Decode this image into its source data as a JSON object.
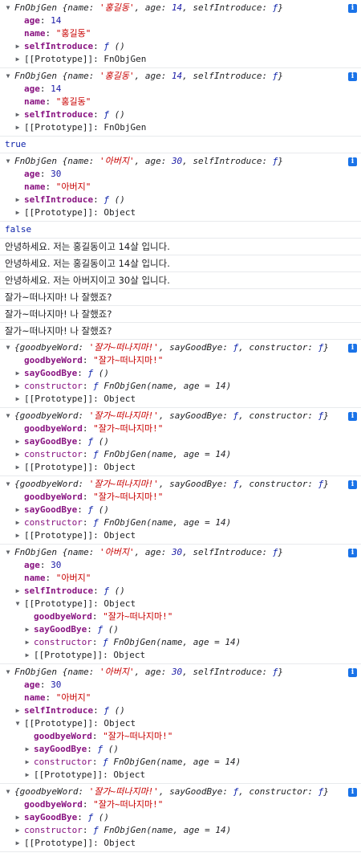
{
  "colors": {
    "string": "#c80000",
    "number": "#1a1aa6",
    "key": "#881280",
    "info_badge": "#1a73e8",
    "separator": "#e8eaed"
  },
  "icons": {
    "expanded": "triangle-down-icon",
    "collapsed": "triangle-right-icon",
    "info": "info-icon"
  },
  "entries": [
    {
      "kind": "object",
      "lines": [
        {
          "indent": 0,
          "tri": "down",
          "html": "<span class='it'>FnObjGen {name: <span class='str'>'홍길동'</span>, age: <span class='num'>14</span>, selfIntroduce: <span class='kw'>ƒ</span>}</span>",
          "info": true
        },
        {
          "indent": 1,
          "tri": "",
          "html": "<span class='keyb'>age</span>: <span class='num'>14</span>"
        },
        {
          "indent": 1,
          "tri": "",
          "html": "<span class='keyb'>name</span>: <span class='str'>\"홍길동\"</span>"
        },
        {
          "indent": 1,
          "tri": "right",
          "html": "<span class='keyb'>selfIntroduce</span>: <span class='it'><span class='kw'>ƒ</span> ()</span>"
        },
        {
          "indent": 1,
          "tri": "right",
          "html": "<span class='dim'>[[Prototype]]</span>: FnObjGen"
        }
      ]
    },
    {
      "kind": "object",
      "lines": [
        {
          "indent": 0,
          "tri": "down",
          "html": "<span class='it'>FnObjGen {name: <span class='str'>'홍길동'</span>, age: <span class='num'>14</span>, selfIntroduce: <span class='kw'>ƒ</span>}</span>",
          "info": true
        },
        {
          "indent": 1,
          "tri": "",
          "html": "<span class='keyb'>age</span>: <span class='num'>14</span>"
        },
        {
          "indent": 1,
          "tri": "",
          "html": "<span class='keyb'>name</span>: <span class='str'>\"홍길동\"</span>"
        },
        {
          "indent": 1,
          "tri": "right",
          "html": "<span class='keyb'>selfIntroduce</span>: <span class='it'><span class='kw'>ƒ</span> ()</span>"
        },
        {
          "indent": 1,
          "tri": "right",
          "html": "<span class='dim'>[[Prototype]]</span>: FnObjGen"
        }
      ]
    },
    {
      "kind": "value",
      "lines": [
        {
          "indent": 0,
          "tri": "",
          "html": "<span class='kw'>true</span>"
        }
      ]
    },
    {
      "kind": "object",
      "lines": [
        {
          "indent": 0,
          "tri": "down",
          "html": "<span class='it'>FnObjGen {name: <span class='str'>'아버지'</span>, age: <span class='num'>30</span>, selfIntroduce: <span class='kw'>ƒ</span>}</span>",
          "info": true
        },
        {
          "indent": 1,
          "tri": "",
          "html": "<span class='keyb'>age</span>: <span class='num'>30</span>"
        },
        {
          "indent": 1,
          "tri": "",
          "html": "<span class='keyb'>name</span>: <span class='str'>\"아버지\"</span>"
        },
        {
          "indent": 1,
          "tri": "right",
          "html": "<span class='keyb'>selfIntroduce</span>: <span class='it'><span class='kw'>ƒ</span> ()</span>"
        },
        {
          "indent": 1,
          "tri": "right",
          "html": "<span class='dim'>[[Prototype]]</span>: Object"
        }
      ]
    },
    {
      "kind": "value",
      "lines": [
        {
          "indent": 0,
          "tri": "",
          "html": "<span class='kw'>false</span>"
        }
      ]
    },
    {
      "kind": "log",
      "lines": [
        {
          "indent": 0,
          "tri": "",
          "html": "<span class='plain'>안녕하세요. 저는 홍길동이고 14살 입니다.</span>"
        }
      ]
    },
    {
      "kind": "log",
      "lines": [
        {
          "indent": 0,
          "tri": "",
          "html": "<span class='plain'>안녕하세요. 저는 홍길동이고 14살 입니다.</span>"
        }
      ]
    },
    {
      "kind": "log",
      "lines": [
        {
          "indent": 0,
          "tri": "",
          "html": "<span class='plain'>안녕하세요. 저는 아버지이고 30살 입니다.</span>"
        }
      ]
    },
    {
      "kind": "log",
      "lines": [
        {
          "indent": 0,
          "tri": "",
          "html": "<span class='plain'>잘가~떠나지마! 나 잘했죠?</span>"
        }
      ]
    },
    {
      "kind": "log",
      "lines": [
        {
          "indent": 0,
          "tri": "",
          "html": "<span class='plain'>잘가~떠나지마! 나 잘했죠?</span>"
        }
      ]
    },
    {
      "kind": "log",
      "lines": [
        {
          "indent": 0,
          "tri": "",
          "html": "<span class='plain'>잘가~떠나지마! 나 잘했죠?</span>"
        }
      ]
    },
    {
      "kind": "object",
      "lines": [
        {
          "indent": 0,
          "tri": "down",
          "html": "<span class='it'>{goodbyeWord: <span class='str'>'잘가~떠나지마!'</span>, sayGoodBye: <span class='kw'>ƒ</span>, constructor: <span class='kw'>ƒ</span>}</span>",
          "info": true
        },
        {
          "indent": 1,
          "tri": "",
          "html": "<span class='keyb'>goodbyeWord</span>: <span class='str'>\"잘가~떠나지마!\"</span>"
        },
        {
          "indent": 1,
          "tri": "right",
          "html": "<span class='keyb'>sayGoodBye</span>: <span class='it'><span class='kw'>ƒ</span> ()</span>"
        },
        {
          "indent": 1,
          "tri": "right",
          "html": "<span class='key'>constructor</span>: <span class='it'><span class='kw'>ƒ</span> FnObjGen(name, age = 14)</span>"
        },
        {
          "indent": 1,
          "tri": "right",
          "html": "<span class='dim'>[[Prototype]]</span>: Object"
        }
      ]
    },
    {
      "kind": "object",
      "lines": [
        {
          "indent": 0,
          "tri": "down",
          "html": "<span class='it'>{goodbyeWord: <span class='str'>'잘가~떠나지마!'</span>, sayGoodBye: <span class='kw'>ƒ</span>, constructor: <span class='kw'>ƒ</span>}</span>",
          "info": true
        },
        {
          "indent": 1,
          "tri": "",
          "html": "<span class='keyb'>goodbyeWord</span>: <span class='str'>\"잘가~떠나지마!\"</span>"
        },
        {
          "indent": 1,
          "tri": "right",
          "html": "<span class='keyb'>sayGoodBye</span>: <span class='it'><span class='kw'>ƒ</span> ()</span>"
        },
        {
          "indent": 1,
          "tri": "right",
          "html": "<span class='key'>constructor</span>: <span class='it'><span class='kw'>ƒ</span> FnObjGen(name, age = 14)</span>"
        },
        {
          "indent": 1,
          "tri": "right",
          "html": "<span class='dim'>[[Prototype]]</span>: Object"
        }
      ]
    },
    {
      "kind": "object",
      "lines": [
        {
          "indent": 0,
          "tri": "down",
          "html": "<span class='it'>{goodbyeWord: <span class='str'>'잘가~떠나지마!'</span>, sayGoodBye: <span class='kw'>ƒ</span>, constructor: <span class='kw'>ƒ</span>}</span>",
          "info": true
        },
        {
          "indent": 1,
          "tri": "",
          "html": "<span class='keyb'>goodbyeWord</span>: <span class='str'>\"잘가~떠나지마!\"</span>"
        },
        {
          "indent": 1,
          "tri": "right",
          "html": "<span class='keyb'>sayGoodBye</span>: <span class='it'><span class='kw'>ƒ</span> ()</span>"
        },
        {
          "indent": 1,
          "tri": "right",
          "html": "<span class='key'>constructor</span>: <span class='it'><span class='kw'>ƒ</span> FnObjGen(name, age = 14)</span>"
        },
        {
          "indent": 1,
          "tri": "right",
          "html": "<span class='dim'>[[Prototype]]</span>: Object"
        }
      ]
    },
    {
      "kind": "object",
      "lines": [
        {
          "indent": 0,
          "tri": "down",
          "html": "<span class='it'>FnObjGen {name: <span class='str'>'아버지'</span>, age: <span class='num'>30</span>, selfIntroduce: <span class='kw'>ƒ</span>}</span>",
          "info": true
        },
        {
          "indent": 1,
          "tri": "",
          "html": "<span class='keyb'>age</span>: <span class='num'>30</span>"
        },
        {
          "indent": 1,
          "tri": "",
          "html": "<span class='keyb'>name</span>: <span class='str'>\"아버지\"</span>"
        },
        {
          "indent": 1,
          "tri": "right",
          "html": "<span class='keyb'>selfIntroduce</span>: <span class='it'><span class='kw'>ƒ</span> ()</span>"
        },
        {
          "indent": 1,
          "tri": "down",
          "html": "<span class='dim'>[[Prototype]]</span>: Object"
        },
        {
          "indent": 2,
          "tri": "",
          "html": "<span class='keyb'>goodbyeWord</span>: <span class='str'>\"잘가~떠나지마!\"</span>"
        },
        {
          "indent": 2,
          "tri": "right",
          "html": "<span class='keyb'>sayGoodBye</span>: <span class='it'><span class='kw'>ƒ</span> ()</span>"
        },
        {
          "indent": 2,
          "tri": "right",
          "html": "<span class='key'>constructor</span>: <span class='it'><span class='kw'>ƒ</span> FnObjGen(name, age = 14)</span>"
        },
        {
          "indent": 2,
          "tri": "right",
          "html": "<span class='dim'>[[Prototype]]</span>: Object"
        }
      ]
    },
    {
      "kind": "object",
      "lines": [
        {
          "indent": 0,
          "tri": "down",
          "html": "<span class='it'>FnObjGen {name: <span class='str'>'아버지'</span>, age: <span class='num'>30</span>, selfIntroduce: <span class='kw'>ƒ</span>}</span>",
          "info": true
        },
        {
          "indent": 1,
          "tri": "",
          "html": "<span class='keyb'>age</span>: <span class='num'>30</span>"
        },
        {
          "indent": 1,
          "tri": "",
          "html": "<span class='keyb'>name</span>: <span class='str'>\"아버지\"</span>"
        },
        {
          "indent": 1,
          "tri": "right",
          "html": "<span class='keyb'>selfIntroduce</span>: <span class='it'><span class='kw'>ƒ</span> ()</span>"
        },
        {
          "indent": 1,
          "tri": "down",
          "html": "<span class='dim'>[[Prototype]]</span>: Object"
        },
        {
          "indent": 2,
          "tri": "",
          "html": "<span class='keyb'>goodbyeWord</span>: <span class='str'>\"잘가~떠나지마!\"</span>"
        },
        {
          "indent": 2,
          "tri": "right",
          "html": "<span class='keyb'>sayGoodBye</span>: <span class='it'><span class='kw'>ƒ</span> ()</span>"
        },
        {
          "indent": 2,
          "tri": "right",
          "html": "<span class='key'>constructor</span>: <span class='it'><span class='kw'>ƒ</span> FnObjGen(name, age = 14)</span>"
        },
        {
          "indent": 2,
          "tri": "right",
          "html": "<span class='dim'>[[Prototype]]</span>: Object"
        }
      ]
    },
    {
      "kind": "object",
      "lines": [
        {
          "indent": 0,
          "tri": "down",
          "html": "<span class='it'>{goodbyeWord: <span class='str'>'잘가~떠나지마!'</span>, sayGoodBye: <span class='kw'>ƒ</span>, constructor: <span class='kw'>ƒ</span>}</span>",
          "info": true
        },
        {
          "indent": 1,
          "tri": "",
          "html": "<span class='keyb'>goodbyeWord</span>: <span class='str'>\"잘가~떠나지마!\"</span>"
        },
        {
          "indent": 1,
          "tri": "right",
          "html": "<span class='keyb'>sayGoodBye</span>: <span class='it'><span class='kw'>ƒ</span> ()</span>"
        },
        {
          "indent": 1,
          "tri": "right",
          "html": "<span class='key'>constructor</span>: <span class='it'><span class='kw'>ƒ</span> FnObjGen(name, age = 14)</span>"
        },
        {
          "indent": 1,
          "tri": "right",
          "html": "<span class='dim'>[[Prototype]]</span>: Object"
        }
      ]
    }
  ]
}
